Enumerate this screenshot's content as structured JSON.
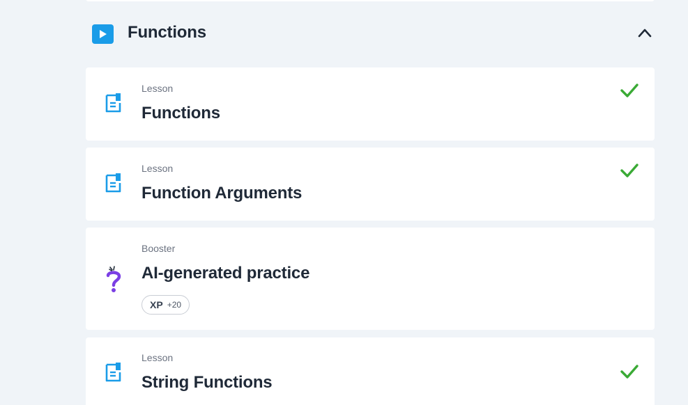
{
  "section": {
    "title": "Functions",
    "icon": "play-icon",
    "toggle_icon": "chevron-up-icon"
  },
  "items": [
    {
      "type": "Lesson",
      "title": "Functions",
      "icon": "lesson-document-icon",
      "completed": true
    },
    {
      "type": "Lesson",
      "title": "Function Arguments",
      "icon": "lesson-document-icon",
      "completed": true
    },
    {
      "type": "Booster",
      "title": "AI-generated practice",
      "icon": "question-mark-icon",
      "completed": false,
      "xp": {
        "label": "XP",
        "amount": "+20"
      }
    },
    {
      "type": "Lesson",
      "title": "String Functions",
      "icon": "lesson-document-icon",
      "completed": true
    }
  ],
  "colors": {
    "accent_blue": "#1a9ce8",
    "check_green": "#3aaa35",
    "booster_purple": "#7b3fe4",
    "background": "#f0f4f8"
  }
}
